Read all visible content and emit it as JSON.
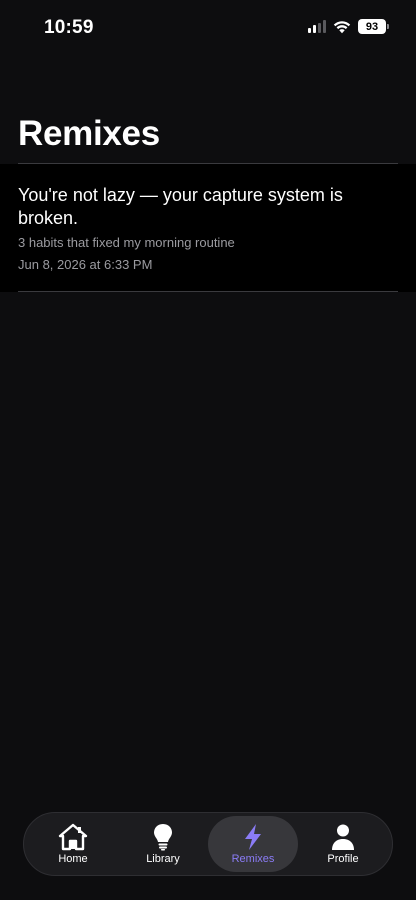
{
  "status_bar": {
    "time": "10:59",
    "battery": "93"
  },
  "page": {
    "title": "Remixes"
  },
  "remixes": [
    {
      "title": "You're not lazy — your capture system is broken.",
      "subtitle": "3 habits that fixed my morning routine",
      "date": "Jun 8, 2026 at 6:33 PM"
    }
  ],
  "tab_bar": {
    "active_color": "#8b7cf6",
    "tabs": [
      {
        "label": "Home",
        "icon": "home-icon"
      },
      {
        "label": "Library",
        "icon": "lightbulb-icon"
      },
      {
        "label": "Remixes",
        "icon": "lightning-icon"
      },
      {
        "label": "Profile",
        "icon": "person-icon"
      }
    ]
  }
}
